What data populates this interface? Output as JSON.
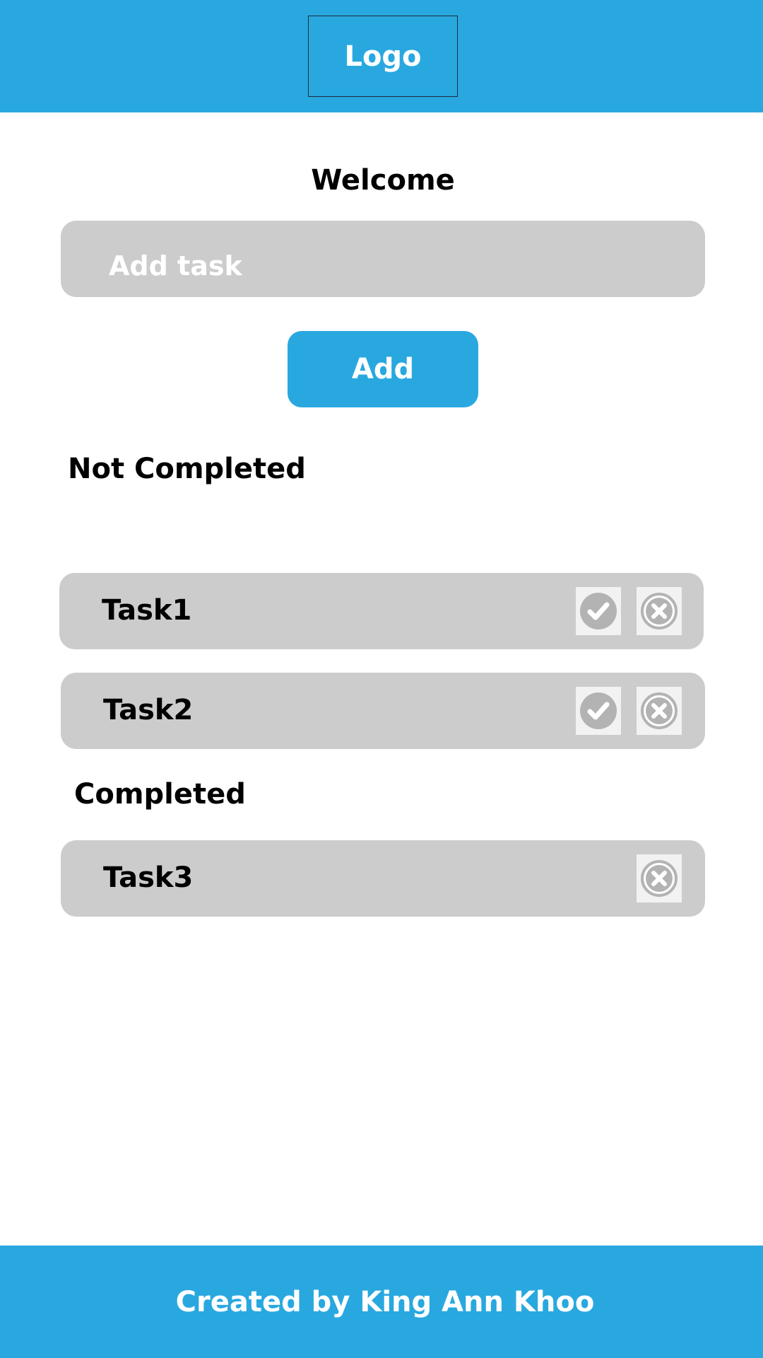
{
  "header": {
    "logo_text": "Logo"
  },
  "main": {
    "welcome": "Welcome",
    "task_input": {
      "placeholder": "Add task",
      "value": ""
    },
    "add_button_label": "Add",
    "sections": {
      "not_completed": {
        "title": "Not Completed",
        "tasks": [
          {
            "label": "Task1"
          },
          {
            "label": "Task2"
          }
        ]
      },
      "completed": {
        "title": "Completed",
        "tasks": [
          {
            "label": "Task3"
          }
        ]
      }
    }
  },
  "footer": {
    "credit": "Created by King Ann Khoo"
  },
  "icons": {
    "complete": "check-circle-icon",
    "delete": "close-circle-icon"
  },
  "colors": {
    "brand_blue": "#29a8e0",
    "task_row_gray": "#cccccc",
    "icon_button_bg": "#f2f2f2",
    "icon_gray": "#b3b3b3"
  }
}
